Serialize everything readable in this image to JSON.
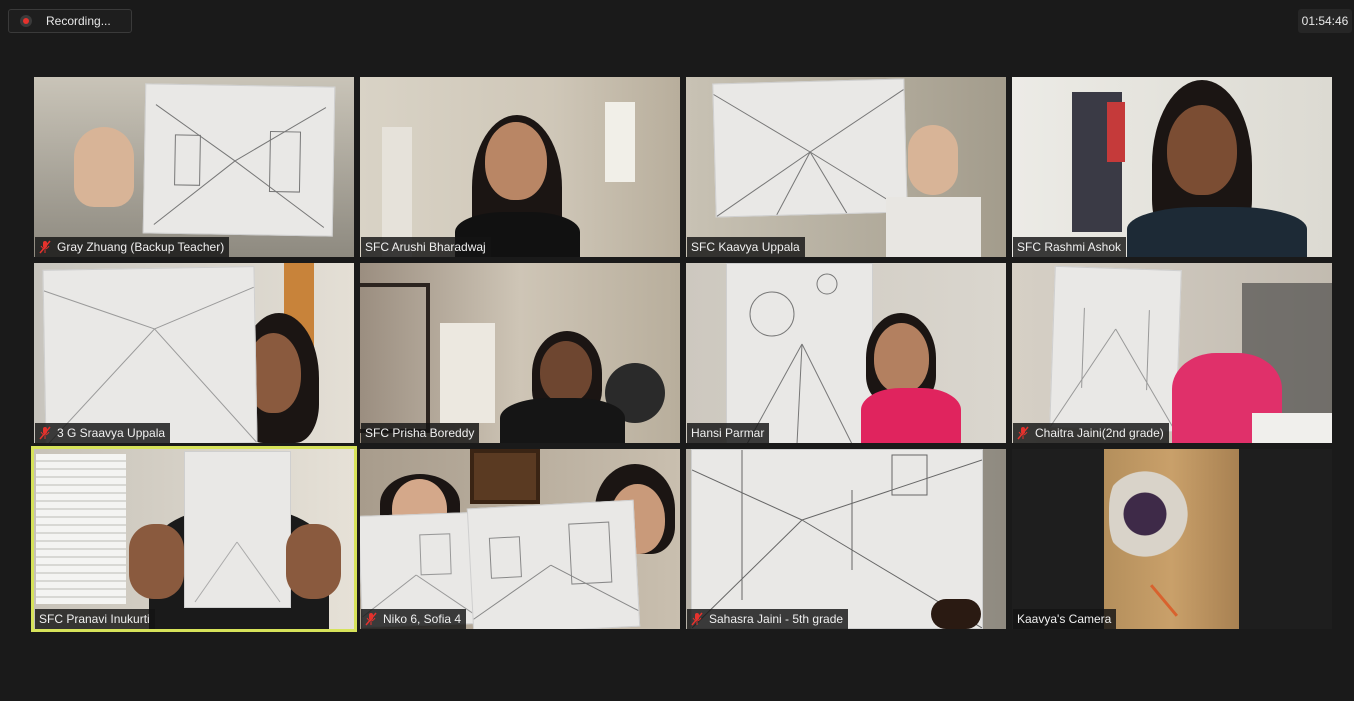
{
  "recording": {
    "label": "Recording..."
  },
  "timer": {
    "elapsed": "01:54:46"
  },
  "colors": {
    "active_speaker": "#d7e35a",
    "muted_mic": "#e5322d",
    "background": "#1a1a1a"
  },
  "participants": [
    {
      "name": "Gray Zhuang (Backup Teacher)",
      "muted": true
    },
    {
      "name": "SFC Arushi Bharadwaj",
      "muted": false
    },
    {
      "name": "SFC Kaavya Uppala",
      "muted": false
    },
    {
      "name": "SFC Rashmi Ashok",
      "muted": false
    },
    {
      "name": "3 G Sraavya Uppala",
      "muted": true
    },
    {
      "name": "SFC Prisha Boreddy",
      "muted": false
    },
    {
      "name": "Hansi Parmar",
      "muted": false
    },
    {
      "name": "Chaitra Jaini(2nd grade)",
      "muted": true
    },
    {
      "name": "SFC Pranavi Inukurti",
      "muted": false,
      "active_speaker": true
    },
    {
      "name": "Niko 6, Sofia 4",
      "muted": true
    },
    {
      "name": "Sahasra Jaini - 5th grade",
      "muted": true
    },
    {
      "name": "Kaavya's Camera",
      "muted": false
    }
  ]
}
